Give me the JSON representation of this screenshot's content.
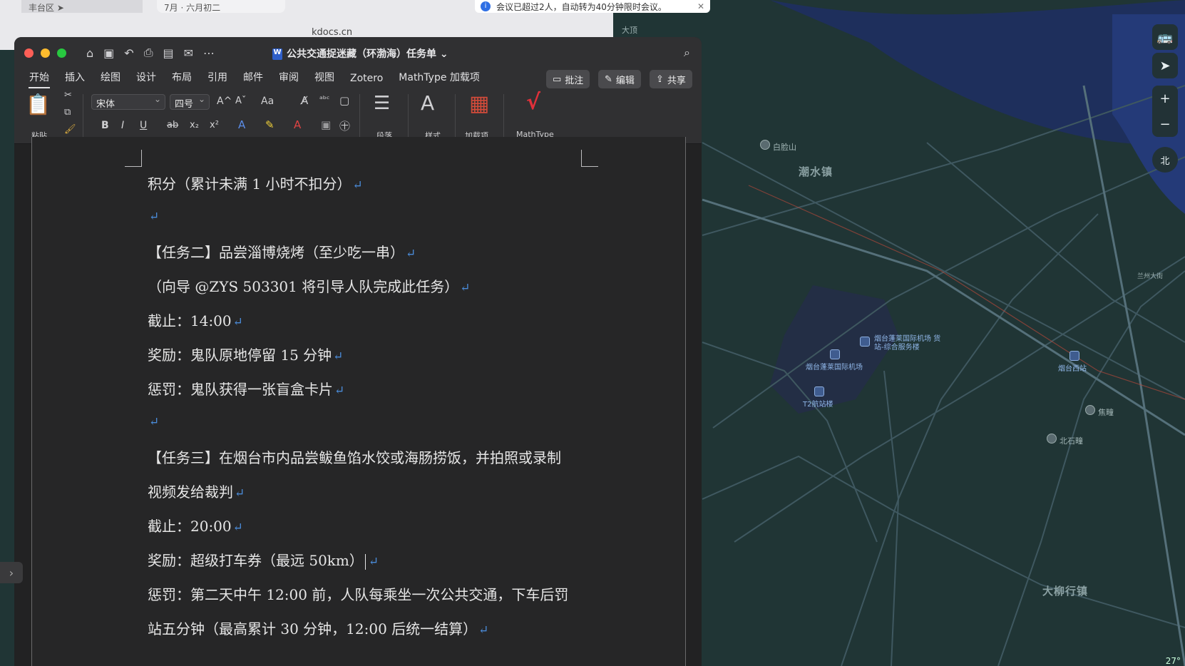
{
  "background": {
    "top_left_label": "丰台区",
    "calendar_tab": "7月 · 六月初二",
    "notice": "会议已超过2人，自动转为40分钟限时会议。",
    "url": "kdocs.cn"
  },
  "map": {
    "labels": {
      "chaoshui": "潮水镇",
      "daliuhang": "大柳行镇",
      "baishan": "白脸山",
      "dading": "大顶",
      "airport": "烟台蓬莱国际机场",
      "cargo": "烟台蓬莱国际机场 货站-综合服务楼",
      "t2": "T2航站楼",
      "yantai_west": "烟台西站",
      "jiaotuan": "焦疃",
      "beishituan": "北石疃",
      "lanzhou": "兰州大街"
    },
    "controls": {
      "bus": "🚌",
      "locate": "➤",
      "zoom_in": "+",
      "zoom_out": "−",
      "north": "北"
    },
    "temperature": "27°"
  },
  "word": {
    "title": "公共交通捉迷藏（环渤海）任务单",
    "tabs": [
      "开始",
      "插入",
      "绘图",
      "设计",
      "布局",
      "引用",
      "邮件",
      "审阅",
      "视图",
      "Zotero",
      "MathType 加载项"
    ],
    "active_tab": "开始",
    "actions": {
      "comment": "批注",
      "edit": "编辑",
      "share": "共享"
    },
    "ribbon": {
      "paste": "粘贴",
      "font_name": "宋体",
      "font_size": "四号",
      "paragraph": "段落",
      "styles": "样式",
      "addins": "加载项",
      "mathtype": "MathType",
      "bold": "B",
      "italic": "I",
      "underline": "U",
      "strike": "ab",
      "sub": "x₂",
      "sup": "x²",
      "grow": "A^",
      "shrink": "Aˇ",
      "case": "Aa"
    },
    "document": {
      "lines": [
        "积分（累计未满 1 小时不扣分）",
        "",
        "【任务二】品尝淄博烧烤（至少吃一串）",
        "（向导 @ZYS 503301 将引导人队完成此任务）",
        "截止：14:00",
        "奖励：鬼队原地停留 15 分钟",
        "惩罚：鬼队获得一张盲盒卡片",
        "",
        "【任务三】在烟台市内品尝鲅鱼馅水饺或海肠捞饭，并拍照或录制",
        "视频发给裁判",
        "截止：20:00",
        "奖励：超级打车券（最远 50km）",
        "惩罚：第二天中午 12:00 前，人队每乘坐一次公共交通，下车后罚",
        "站五分钟（最高累计 30 分钟，12:00 后统一结算）"
      ]
    }
  }
}
